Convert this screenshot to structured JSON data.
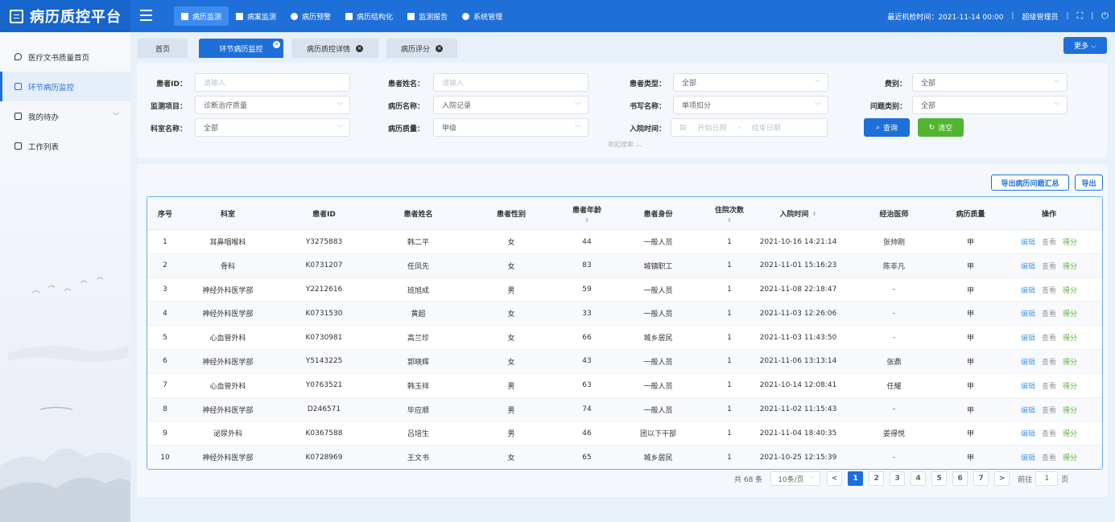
{
  "app": {
    "title": "病历质控平台"
  },
  "nav": [
    {
      "label": "病历监测",
      "active": true
    },
    {
      "label": "病案监测"
    },
    {
      "label": "病历预警"
    },
    {
      "label": "病历结构化"
    },
    {
      "label": "监测报告"
    },
    {
      "label": "系统管理"
    }
  ],
  "topright": {
    "last_check": "最近机检时间：2021-11-14 00:00",
    "user": "超级管理员",
    "sep": "|"
  },
  "sidebar": {
    "items": [
      {
        "label": "医疗文书质量首页"
      },
      {
        "label": "环节病历监控"
      },
      {
        "label": "我的待办"
      },
      {
        "label": "工作列表"
      }
    ]
  },
  "tabs": {
    "home": "首页",
    "t1": "环节病历监控",
    "t2": "病历质控详情",
    "t3": "病历评分",
    "close": "×",
    "more": "更多 ⌵"
  },
  "filter": {
    "patient_id_label": "患者ID：",
    "patient_id_placeholder": "请输入",
    "patient_name_label": "患者姓名：",
    "patient_name_placeholder": "请输入",
    "patient_type_label": "患者类型：",
    "patient_type_value": "全部",
    "fee_label": "费别：",
    "fee_value": "全部",
    "monitor_item_label": "监测项目：",
    "monitor_item_value": "诊断治疗质量",
    "record_name_label": "病历名称：",
    "record_name_value": "入院记录",
    "write_name_label": "书写名称：",
    "write_name_value": "单项扣分",
    "problem_type_label": "问题类别：",
    "problem_type_value": "全部",
    "dept_label": "科室名称：",
    "dept_value": "全部",
    "quality_label": "病历质量：",
    "quality_value": "甲级",
    "admit_label": "入院时间：",
    "start_date": "开始日期",
    "dash": "-",
    "end_date": "结束日期",
    "query": "查询",
    "clear": "清空",
    "collapse": "收起搜索 ︿"
  },
  "actions": {
    "export_summary": "导出病历问题汇总",
    "export": "导出"
  },
  "table": {
    "headers": {
      "no": "序号",
      "dept": "科室",
      "pid": "患者ID",
      "name": "患者姓名",
      "sex": "患者性别",
      "age": "患者年龄",
      "identity": "患者身份",
      "visits": "住院次数",
      "admit": "入院时间",
      "doctor": "经治医师",
      "quality": "病历质量",
      "ops": "操作"
    },
    "sort_icon": "⬍",
    "rows": [
      {
        "no": "1",
        "dept": "耳鼻咽喉科",
        "pid": "Y3275883",
        "name": "韩二平",
        "sex": "女",
        "age": "44",
        "identity": "一般人员",
        "visits": "1",
        "admit": "2021-10-16 14:21:14",
        "doctor": "张帅刚",
        "quality": "甲"
      },
      {
        "no": "2",
        "dept": "骨科",
        "pid": "K0731207",
        "name": "任凤先",
        "sex": "女",
        "age": "83",
        "identity": "城镇职工",
        "visits": "1",
        "admit": "2021-11-01 15:16:23",
        "doctor": "陈非凡",
        "quality": "甲"
      },
      {
        "no": "3",
        "dept": "神经外科医学部",
        "pid": "Y2212616",
        "name": "班旭成",
        "sex": "男",
        "age": "59",
        "identity": "一般人员",
        "visits": "1",
        "admit": "2021-11-08 22:18:47",
        "doctor": "-",
        "quality": "甲"
      },
      {
        "no": "4",
        "dept": "神经外科医学部",
        "pid": "K0731530",
        "name": "黄超",
        "sex": "女",
        "age": "33",
        "identity": "一般人员",
        "visits": "1",
        "admit": "2021-11-03 12:26:06",
        "doctor": "-",
        "quality": "甲"
      },
      {
        "no": "5",
        "dept": "心血管外科",
        "pid": "K0730981",
        "name": "高兰珍",
        "sex": "女",
        "age": "66",
        "identity": "城乡居民",
        "visits": "1",
        "admit": "2021-11-03 11:43:50",
        "doctor": "-",
        "quality": "甲"
      },
      {
        "no": "6",
        "dept": "神经外科医学部",
        "pid": "Y5143225",
        "name": "郭晓辉",
        "sex": "女",
        "age": "43",
        "identity": "一般人员",
        "visits": "1",
        "admit": "2021-11-06 13:13:14",
        "doctor": "张鼎",
        "quality": "甲"
      },
      {
        "no": "7",
        "dept": "心血管外科",
        "pid": "Y0763521",
        "name": "韩玉祥",
        "sex": "男",
        "age": "63",
        "identity": "一般人员",
        "visits": "1",
        "admit": "2021-10-14 12:08:41",
        "doctor": "任耀",
        "quality": "甲"
      },
      {
        "no": "8",
        "dept": "神经外科医学部",
        "pid": "D246571",
        "name": "毕应顺",
        "sex": "男",
        "age": "74",
        "identity": "一般人员",
        "visits": "1",
        "admit": "2021-11-02 11:15:43",
        "doctor": "-",
        "quality": "甲"
      },
      {
        "no": "9",
        "dept": "泌尿外科",
        "pid": "K0367588",
        "name": "吕培生",
        "sex": "男",
        "age": "46",
        "identity": "团以下干部",
        "visits": "1",
        "admit": "2021-11-04 18:40:35",
        "doctor": "姜得悦",
        "quality": "甲"
      },
      {
        "no": "10",
        "dept": "神经外科医学部",
        "pid": "K0728969",
        "name": "王文书",
        "sex": "女",
        "age": "65",
        "identity": "城乡居民",
        "visits": "1",
        "admit": "2021-10-25 12:15:39",
        "doctor": "-",
        "quality": "甲"
      }
    ],
    "ops": {
      "edit": "编辑",
      "view": "查看",
      "score": "得分"
    }
  },
  "pagination": {
    "total": "共 68 条",
    "page_size": "10条/页",
    "pages": [
      "1",
      "2",
      "3",
      "4",
      "5",
      "6",
      "7"
    ],
    "prev": "<",
    "next": ">",
    "goto": "前往",
    "goto_value": "1",
    "page_unit": "页"
  }
}
